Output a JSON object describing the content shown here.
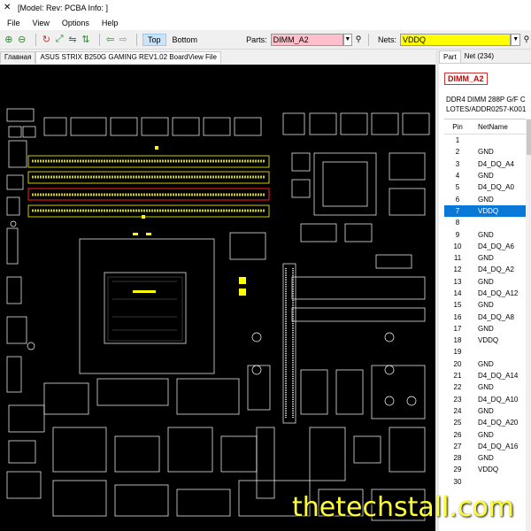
{
  "window": {
    "title": "[Model: Rev:  PCBA Info: ]"
  },
  "menu": [
    "File",
    "View",
    "Options",
    "Help"
  ],
  "toolbar": {
    "side_top": "Top",
    "side_bottom": "Bottom",
    "parts_label": "Parts:",
    "parts_value": "DIMM_A2",
    "nets_label": "Nets:",
    "nets_value": "VDDQ"
  },
  "doc_tabs": [
    "Главная",
    "ASUS STRIX B250G GAMING REV1.02 BoardView File"
  ],
  "panel": {
    "tabs": [
      "Part",
      "Net (234)"
    ],
    "part_name": "DIMM_A2",
    "part_desc_1": "DDR4 DIMM 288P G/F C",
    "part_desc_2": "LOTES/ADDR0257-K001",
    "col_pin": "Pin",
    "col_net": "NetName",
    "rows": [
      {
        "pin": "1",
        "net": ""
      },
      {
        "pin": "2",
        "net": "GND"
      },
      {
        "pin": "3",
        "net": "D4_DQ_A4"
      },
      {
        "pin": "4",
        "net": "GND"
      },
      {
        "pin": "5",
        "net": "D4_DQ_A0"
      },
      {
        "pin": "6",
        "net": "GND"
      },
      {
        "pin": "7",
        "net": "VDDQ"
      },
      {
        "pin": "8",
        "net": ""
      },
      {
        "pin": "9",
        "net": "GND"
      },
      {
        "pin": "10",
        "net": "D4_DQ_A6"
      },
      {
        "pin": "11",
        "net": "GND"
      },
      {
        "pin": "12",
        "net": "D4_DQ_A2"
      },
      {
        "pin": "13",
        "net": "GND"
      },
      {
        "pin": "14",
        "net": "D4_DQ_A12"
      },
      {
        "pin": "15",
        "net": "GND"
      },
      {
        "pin": "16",
        "net": "D4_DQ_A8"
      },
      {
        "pin": "17",
        "net": "GND"
      },
      {
        "pin": "18",
        "net": "VDDQ"
      },
      {
        "pin": "19",
        "net": ""
      },
      {
        "pin": "20",
        "net": "GND"
      },
      {
        "pin": "21",
        "net": "D4_DQ_A14"
      },
      {
        "pin": "22",
        "net": "GND"
      },
      {
        "pin": "23",
        "net": "D4_DQ_A10"
      },
      {
        "pin": "24",
        "net": "GND"
      },
      {
        "pin": "25",
        "net": "D4_DQ_A20"
      },
      {
        "pin": "26",
        "net": "GND"
      },
      {
        "pin": "27",
        "net": "D4_DQ_A16"
      },
      {
        "pin": "28",
        "net": "GND"
      },
      {
        "pin": "29",
        "net": "VDDQ"
      },
      {
        "pin": "30",
        "net": ""
      }
    ],
    "selected_pin": "7"
  },
  "watermark": "thetechstall.com",
  "colors": {
    "board_bg": "#000000",
    "outline": "#ffffff",
    "highlight_part": "#ff2020",
    "highlight_net": "#ffff00"
  }
}
